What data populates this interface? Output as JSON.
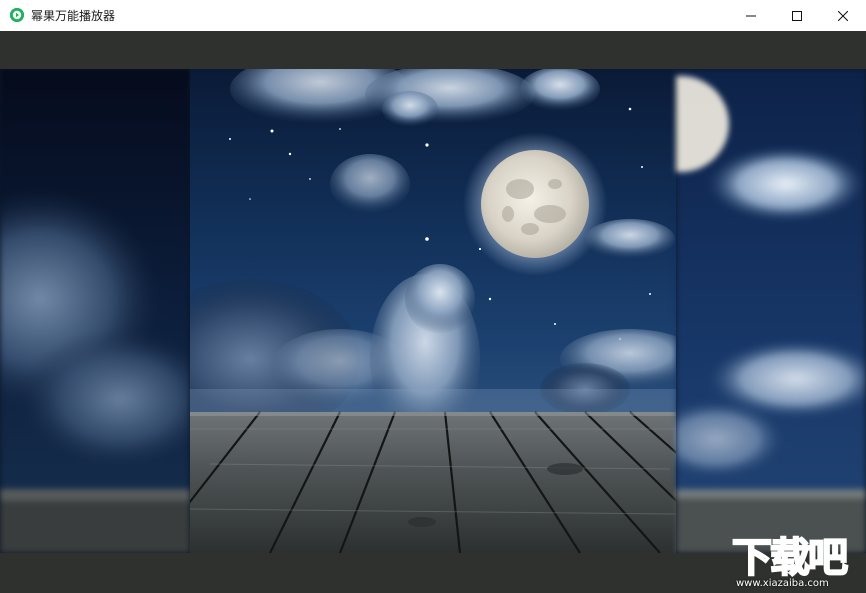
{
  "window": {
    "title": "幂果万能播放器",
    "app_icon": "play-circle-icon",
    "controls": {
      "minimize_icon": "minimize-icon",
      "maximize_icon": "maximize-icon",
      "close_icon": "close-icon"
    }
  },
  "stage": {
    "content": "video-frame",
    "left_panel": "blurred-extension",
    "right_panel": "blurred-extension"
  },
  "watermark": {
    "brand": "下载吧",
    "site": "www.xiazaiba.com"
  },
  "colors": {
    "titlebar_bg": "#ffffff",
    "chrome_bg": "#2f312e",
    "app_accent": "#1fb35a",
    "close_hover": "#e81123"
  }
}
